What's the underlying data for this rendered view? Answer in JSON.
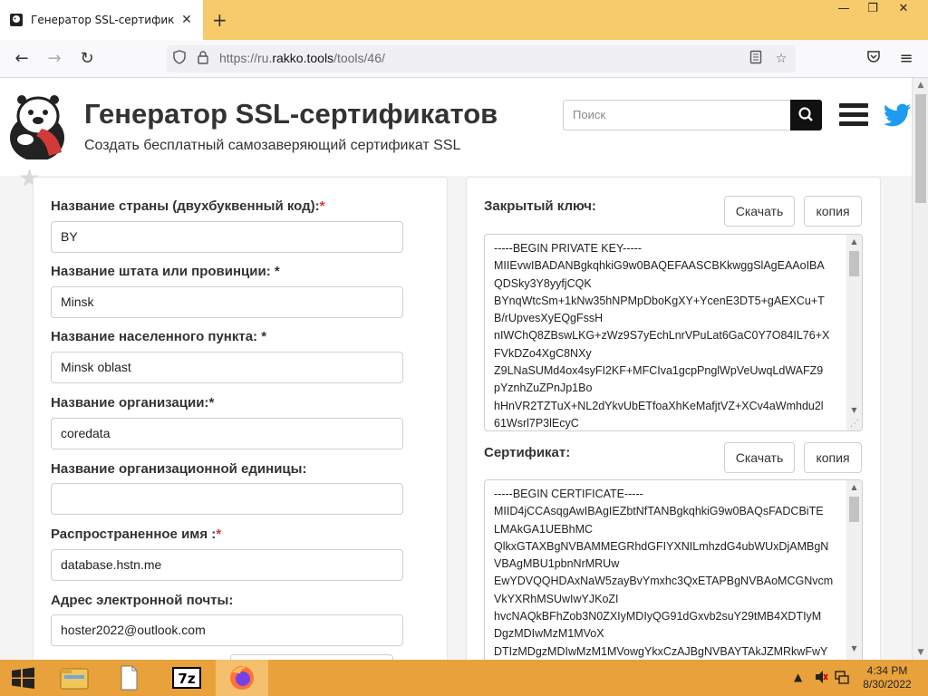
{
  "browser": {
    "tab_title": "Генератор SSL-сертификатов |",
    "url_prefix": "https://ru.",
    "url_domain": "rakko.tools",
    "url_path": "/tools/46/"
  },
  "header": {
    "title": "Генератор SSL-сертификатов",
    "subtitle": "Создать бесплатный самозаверяющий сертификат SSL",
    "search_placeholder": "Поиск"
  },
  "form": {
    "country_label": "Название страны (двухбуквенный код):",
    "country_value": "BY",
    "state_label": "Название штата или провинции: ",
    "state_value": "Minsk",
    "locality_label": "Название населенного пункта: ",
    "locality_value": "Minsk oblast",
    "org_label": "Название организации:",
    "org_value": "coredata",
    "unit_label": "Название организационной единицы:",
    "unit_value": "",
    "cn_label": "Распространенное имя :",
    "cn_value": "database.hstn.me",
    "email_label": "Адрес электронной почты:",
    "email_value": "hoster2022@outlook.com",
    "required_mark": "*"
  },
  "output": {
    "private_key_label": "Закрытый ключ:",
    "certificate_label": "Сертификат:",
    "download_label": "Скачать",
    "copy_label": "копия",
    "private_key_text": "-----BEGIN PRIVATE KEY-----\nMIIEvwIBADANBgkqhkiG9w0BAQEFAASCBKkwggSlAgEAAoIBA\nQDSky3Y8yyfjCQK\nBYnqWtcSm+1kNw35hNPMpDboKgXY+YcenE3DT5+gAEXCu+T\nB/rUpvesXyEQgFssH\nnIWChQ8ZBswLKG+zWz9S7yEchLnrVPuLat6GaC0Y7O84IL76+X\nFVkDZo4XgC8NXy\nZ9LNaSUMd4ox4syFI2KF+MFCIva1gcpPnglWpVeUwqLdWAFZ9\npYznhZuZPnJp1Bo\nhHnVR2TZTuX+NL2dYkvUbETfoaXhKeMafjtVZ+XCv4aWmhdu2l\n61Wsrl7P3lEcyC",
    "certificate_text": "-----BEGIN CERTIFICATE-----\nMIID4jCCAsqgAwIBAgIEZbtNfTANBgkqhkiG9w0BAQsFADCBiTE\nLMAkGA1UEBhMC\nQlkxGTAXBgNVBAMMEGRhdGFIYXNILmhzdG4ubWUxDjAMBgN\nVBAgMBU1pbnNrMRUw\nEwYDVQQHDAxNaW5zayBvYmxhc3QxETAPBgNVBAoMCGNvcm\nVkYXRhMSUwIwYJKoZI\nhvcNAQkBFhZob3N0ZXIyMDIyQG91dGxvb2suY29tMB4XDTIyM\nDgzMDIwMzM1MVoX\nDTIzMDgzMDIwMzM1MVowgYkxCzAJBgNVBAYTAkJZMRkwFwY"
  },
  "taskbar": {
    "time": "4:34 PM",
    "date": "8/30/2022"
  },
  "colors": {
    "tabbar": "#f7cb6b",
    "taskbar": "#e9a23b",
    "required": "#e03131",
    "twitter": "#1d9bf0"
  }
}
